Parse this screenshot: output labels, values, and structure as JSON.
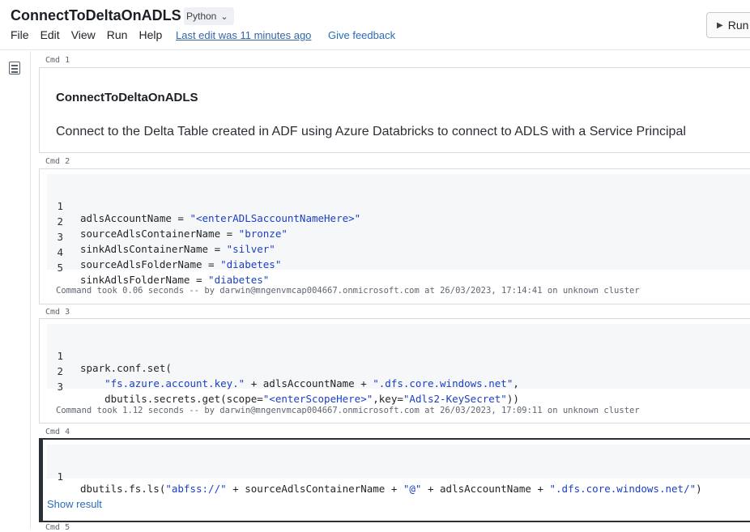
{
  "header": {
    "title": "ConnectToDeltaOnADLS",
    "language": "Python",
    "menu": [
      "File",
      "Edit",
      "View",
      "Run",
      "Help"
    ],
    "last_edit": "Last edit was 11 minutes ago",
    "feedback": "Give feedback",
    "run_label": "Run"
  },
  "sidebar": {
    "toc_icon": "table-of-contents-icon"
  },
  "cells": [
    {
      "label": "Cmd 1",
      "heading": "ConnectToDeltaOnADLS",
      "text": "Connect to the Delta Table created in ADF using Azure Databricks to connect to ADLS with a Service Principal"
    },
    {
      "label": "Cmd 2",
      "lines": [
        {
          "n": "1",
          "pre": "adlsAccountName = ",
          "str": "\"<enterADLSaccountNameHere>\"",
          "post": ""
        },
        {
          "n": "2",
          "pre": "sourceAdlsContainerName = ",
          "str": "\"bronze\"",
          "post": ""
        },
        {
          "n": "3",
          "pre": "sinkAdlsContainerName = ",
          "str": "\"silver\"",
          "post": ""
        },
        {
          "n": "4",
          "pre": "sourceAdlsFolderName = ",
          "str": "\"diabetes\"",
          "post": ""
        },
        {
          "n": "5",
          "pre": "sinkAdlsFolderName = ",
          "str": "\"diabetes\"",
          "post": ""
        }
      ],
      "output": "Command took 0.06 seconds -- by darwin@mngenvmcap004667.onmicrosoft.com at 26/03/2023, 17:14:41 on unknown cluster"
    },
    {
      "label": "Cmd 3",
      "line1": {
        "n": "1",
        "code": "spark.conf.set("
      },
      "line2": {
        "n": "2",
        "indent": "    ",
        "s1": "\"fs.azure.account.key.\"",
        "mid": " + adlsAccountName + ",
        "s2": "\".dfs.core.windows.net\"",
        "end": ","
      },
      "line3": {
        "n": "3",
        "indent": "    ",
        "a": "dbutils.secrets.get(scope=",
        "s1": "\"<enterScopeHere>\"",
        "b": ",key=",
        "s2": "\"Adls2-KeySecret\"",
        "c": "))"
      },
      "output": "Command took 1.12 seconds -- by darwin@mngenvmcap004667.onmicrosoft.com at 26/03/2023, 17:09:11 on unknown cluster"
    },
    {
      "label": "Cmd 4",
      "line1": {
        "n": "1",
        "a": "dbutils.fs.ls(",
        "s1": "\"abfss://\"",
        "b": " + sourceAdlsContainerName + ",
        "s2": "\"@\"",
        "c": " + adlsAccountName + ",
        "s3": "\".dfs.core.windows.net/\"",
        "d": ")"
      },
      "show_result": "Show result"
    }
  ],
  "next_cell_label": "Cmd 5"
}
